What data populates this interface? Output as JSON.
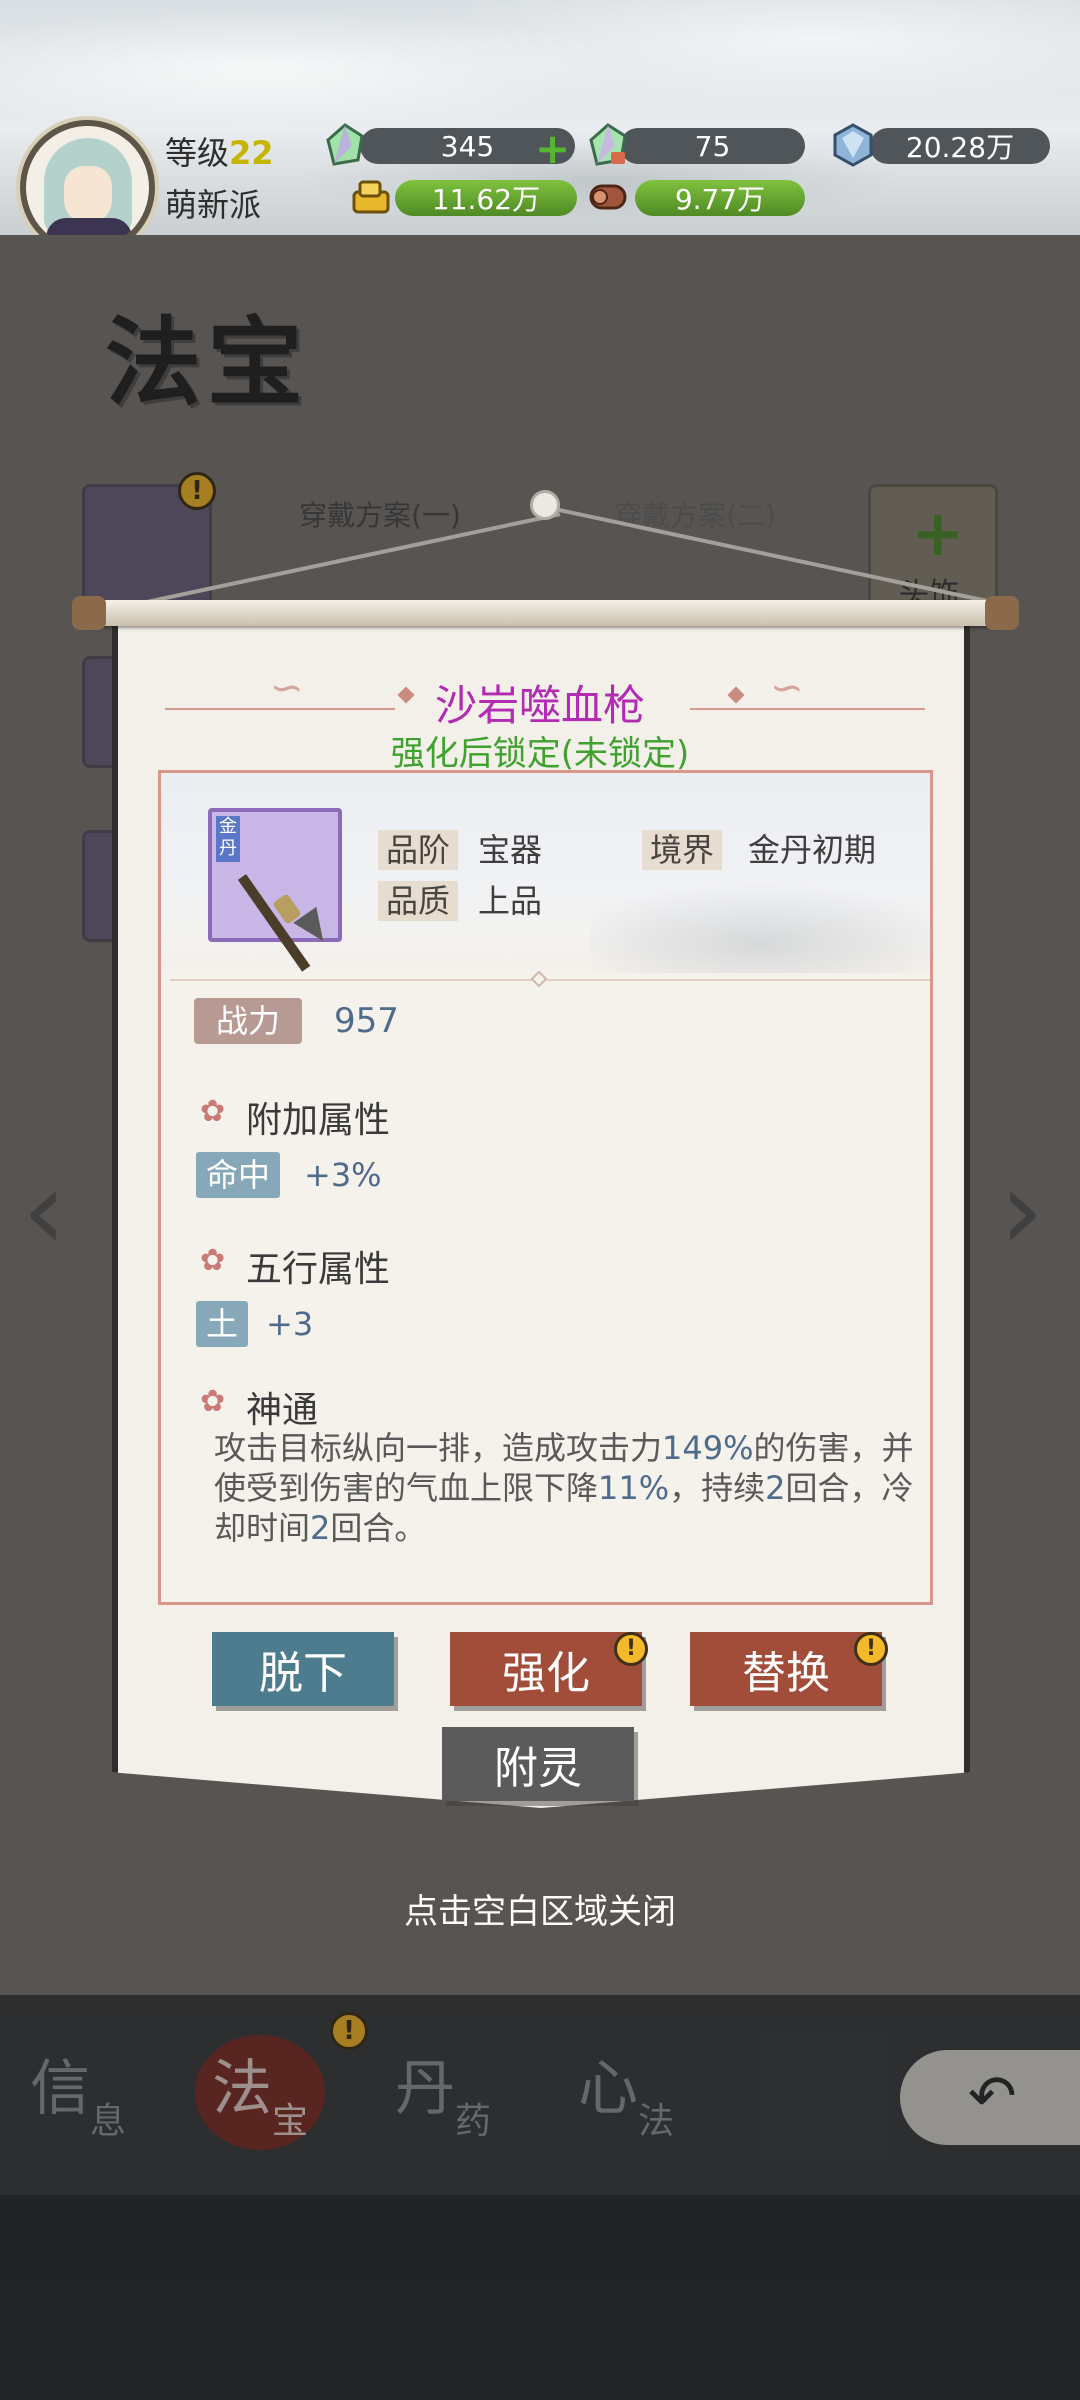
{
  "player": {
    "level_label": "等级",
    "level": "22",
    "sect": "萌新派"
  },
  "resources": {
    "jade": "345",
    "jade_locked": "75",
    "crystal": "20.28万",
    "gold": "11.62万",
    "wood": "9.77万"
  },
  "page": {
    "title": "法宝",
    "plan_tabs": [
      "穿戴方案(一)",
      "穿戴方案(二)"
    ],
    "slot_head": "头饰"
  },
  "item": {
    "name": "沙岩噬血枪",
    "lock_status": "强化后锁定(未锁定)",
    "icon_tag": "金丹",
    "grade_label": "品阶",
    "grade": "宝器",
    "realm_label": "境界",
    "realm": "金丹初期",
    "quality_label": "品质",
    "quality": "上品",
    "power_label": "战力",
    "power": "957",
    "extra_title": "附加属性",
    "extra_attr_label": "命中",
    "extra_attr_value": "+3%",
    "element_title": "五行属性",
    "element_label": "土",
    "element_value": "+3",
    "skill_title": "神通",
    "skill_desc_1": "攻击目标纵向一排，造成攻击力",
    "skill_desc_2": "149%",
    "skill_desc_3": "的伤害，并使受到伤害的气血上限下降",
    "skill_desc_4": "11%",
    "skill_desc_5": "，持续",
    "skill_desc_6": "2",
    "skill_desc_7": "回合，冷却时间",
    "skill_desc_8": "2",
    "skill_desc_9": "回合。"
  },
  "buttons": {
    "unequip": "脱下",
    "enhance": "强化",
    "replace": "替换",
    "enchant": "附灵"
  },
  "close_hint": "点击空白区域关闭",
  "nav": {
    "info_big": "信",
    "info_small": "息",
    "treasure_big": "法",
    "treasure_small": "宝",
    "pill_big": "丹",
    "pill_small": "药",
    "method_big": "心",
    "method_small": "法"
  },
  "colors": {
    "item_name": "#b12bb3",
    "lock_text": "#3fa12e",
    "btn_blue": "#4e7c8f",
    "btn_red": "#a24c3a",
    "btn_gray": "#5b5b5b"
  }
}
